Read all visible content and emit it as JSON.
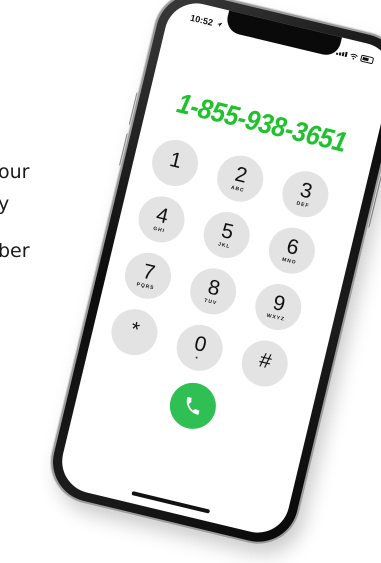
{
  "background_text": [
    "our",
    "y",
    "ber"
  ],
  "status_bar": {
    "time": "10:52",
    "location_icon": "location-arrow-icon",
    "signal_icon": "signal-bars-icon",
    "wifi_icon": "wifi-icon",
    "battery_icon": "battery-icon"
  },
  "dialer": {
    "number": "1-855-938-3651",
    "number_color": "#1fc22c",
    "keys": [
      {
        "digit": "1",
        "letters": ""
      },
      {
        "digit": "2",
        "letters": "ABC"
      },
      {
        "digit": "3",
        "letters": "DEF"
      },
      {
        "digit": "4",
        "letters": "GHI"
      },
      {
        "digit": "5",
        "letters": "JKL"
      },
      {
        "digit": "6",
        "letters": "MNO"
      },
      {
        "digit": "7",
        "letters": "PQRS"
      },
      {
        "digit": "8",
        "letters": "TUV"
      },
      {
        "digit": "9",
        "letters": "WXYZ"
      },
      {
        "digit": "*",
        "letters": ""
      },
      {
        "digit": "0",
        "letters": "+"
      },
      {
        "digit": "#",
        "letters": ""
      }
    ],
    "call_icon": "phone-icon",
    "call_color": "#2fbf53"
  }
}
